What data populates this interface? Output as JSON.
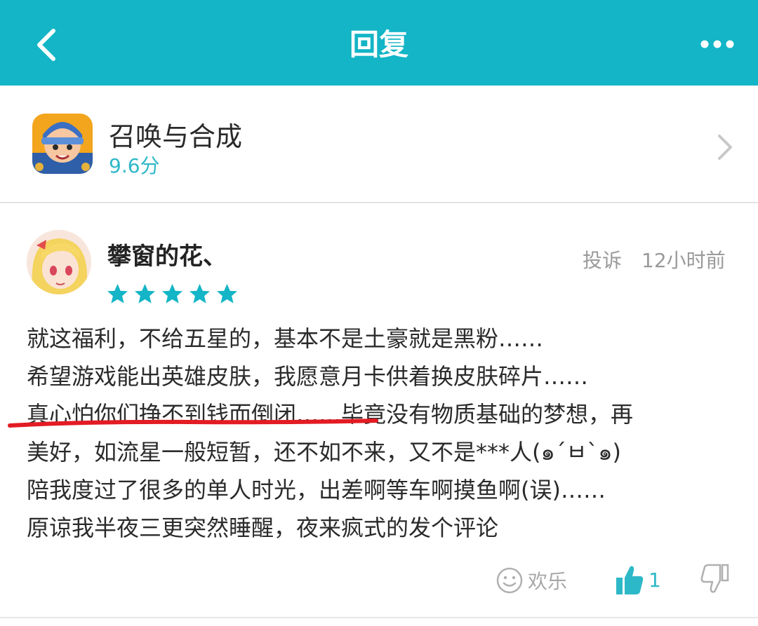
{
  "header": {
    "title": "回复",
    "back_icon": "chevron-left-icon",
    "more_icon": "more-dots-icon",
    "color": "#13b5c6"
  },
  "app": {
    "name": "召唤与合成",
    "score": "9.6分",
    "icon": "game-app-icon"
  },
  "review": {
    "user_name": "攀窗的花、",
    "rating": 5,
    "report_label": "投诉",
    "time": "12小时前",
    "lines": [
      "就这福利，不给五星的，基本不是土豪就是黑粉……",
      "希望游戏能出英雄皮肤，我愿意月卡供着换皮肤碎片……",
      "真心怕你们挣不到钱而倒闭……毕竟没有物质基础的梦想，再",
      "美好，如流星一般短暂，还不如不来，又不是***人(๑´ㅂ`๑)",
      "陪我度过了很多的单人时光，出差啊等车啊摸鱼啊(误)……",
      "原谅我半夜三更突然睡醒，夜来疯式的发个评论"
    ],
    "star_color": "#13b5c6",
    "highlight_color": "#e31b23"
  },
  "actions": {
    "fun_label": "欢乐",
    "like_count": "1",
    "accent": "#2db8c8"
  }
}
